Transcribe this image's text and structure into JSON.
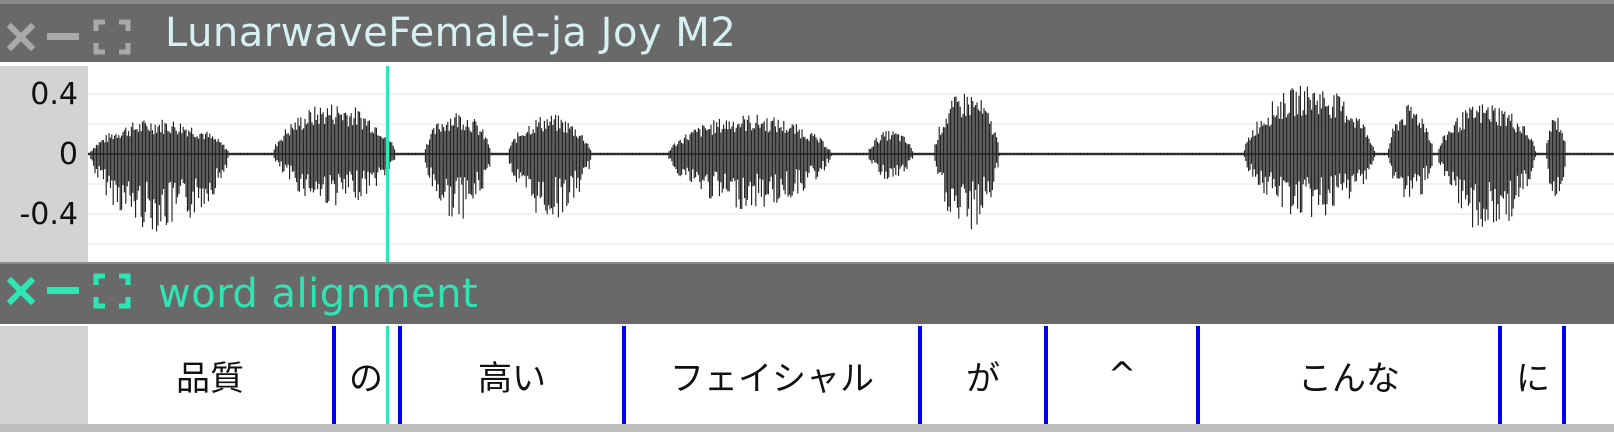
{
  "tracks": {
    "audio": {
      "title": "LunarwaveFemale-ja Joy M2",
      "title_color": "#d7f0f2",
      "icon_color": "#a9a9a9",
      "y_ticks": [
        "0.4",
        "0",
        "-0.4"
      ],
      "y_range": [
        -0.5,
        0.5
      ]
    },
    "alignment": {
      "title": "word alignment",
      "title_color": "#2ee6b4",
      "icon_color": "#2ee6b4",
      "words": [
        "品質",
        "の",
        "高い",
        "フェイシャル",
        "が",
        "^",
        "こんな",
        "に"
      ]
    }
  },
  "colors": {
    "header_bg": "#696969",
    "cursor": "#2ee6b4",
    "boundary": "#0000ee",
    "waveform": "#1a1a1a"
  },
  "icons": {
    "close": "close-icon",
    "minimize": "minimize-icon",
    "maximize": "maximize-icon"
  }
}
